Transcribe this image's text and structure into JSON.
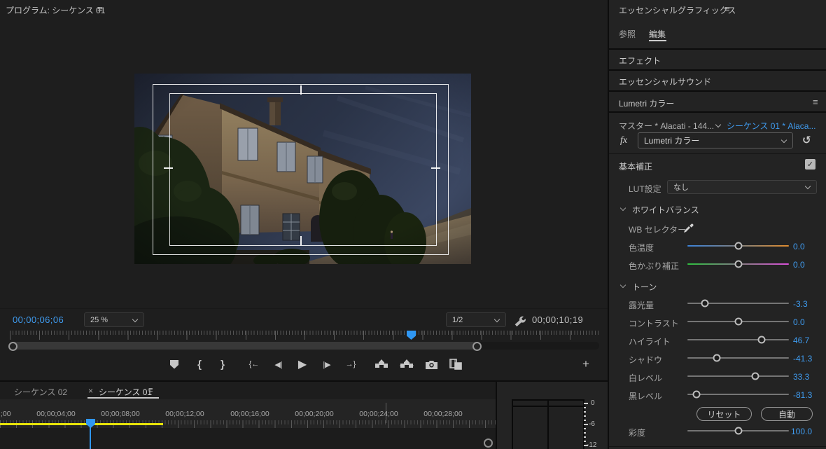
{
  "program_monitor": {
    "title": "プログラム: シーケンス 01",
    "menu_glyph": "≡",
    "current_timecode": "00;00;06;06",
    "zoom_level": "25 %",
    "playback_resolution": "1/2",
    "duration_timecode": "00;00;10;19",
    "plus_glyph": "+",
    "transport": {
      "mark_in": "{",
      "mark_out": "}",
      "go_to_in": "{←",
      "step_back": "◀|",
      "play": "▶",
      "step_forward": "|▶",
      "go_to_out": "→}"
    }
  },
  "essential_graphics": {
    "title": "エッセンシャルグラフィックス",
    "menu_glyph": "≡",
    "tabs": [
      {
        "label": "参照",
        "active": false
      },
      {
        "label": "編集",
        "active": true
      }
    ]
  },
  "stack_panels": {
    "effects": "エフェクト",
    "essential_sound": "エッセンシャルサウンド"
  },
  "lumetri": {
    "title": "Lumetri カラー",
    "menu_glyph": "≡",
    "master_clip": "マスター * Alacati - 144...",
    "sequence_clip": "シーケンス 01 * Alaca...",
    "fx_badge": "fx",
    "effect_name": "Lumetri カラー",
    "reset_glyph": "↺",
    "basic_correction": "基本補正",
    "check_glyph": "✓",
    "lut_label": "LUT設定",
    "lut_value": "なし",
    "white_balance_label": "ホワイトバランス",
    "wb_selector_label": "WB セレクター",
    "wb_sliders": [
      {
        "label": "色温度",
        "value": "0.0",
        "pos": "50%",
        "type": "temperature"
      },
      {
        "label": "色かぶり補正",
        "value": "0.0",
        "pos": "50%",
        "type": "tint"
      }
    ],
    "tone_label": "トーン",
    "tone_sliders": [
      {
        "label": "露光量",
        "value": "-3.3",
        "pos": "17%"
      },
      {
        "label": "コントラスト",
        "value": "0.0",
        "pos": "50%"
      },
      {
        "label": "ハイライト",
        "value": "46.7",
        "pos": "73%"
      },
      {
        "label": "シャドウ",
        "value": "-41.3",
        "pos": "29%"
      },
      {
        "label": "白レベル",
        "value": "33.3",
        "pos": "67%"
      },
      {
        "label": "黒レベル",
        "value": "-81.3",
        "pos": "9%"
      }
    ],
    "reset_button": "リセット",
    "auto_button": "自動",
    "saturation": {
      "label": "彩度",
      "value": "100.0",
      "pos": "50%"
    }
  },
  "timeline": {
    "tabs": [
      {
        "label": "シーケンス 02",
        "active": false
      },
      {
        "label": "シーケンス 01",
        "active": true,
        "close_glyph": "×",
        "menu_glyph": "≡"
      }
    ],
    "ruler_labels": [
      ";00",
      "00;00;04;00",
      "00;00;08;00",
      "00;00;12;00",
      "00;00;16;00",
      "00;00;20;00",
      "00;00;24;00",
      "00;00;28;00"
    ]
  },
  "audio_meter": {
    "scale_labels": [
      "0",
      "-6",
      "-12"
    ]
  },
  "colors": {
    "accent_blue": "#3f9bef",
    "playhead_blue": "#2f97f3",
    "render_bar_yellow": "#e8e409"
  }
}
